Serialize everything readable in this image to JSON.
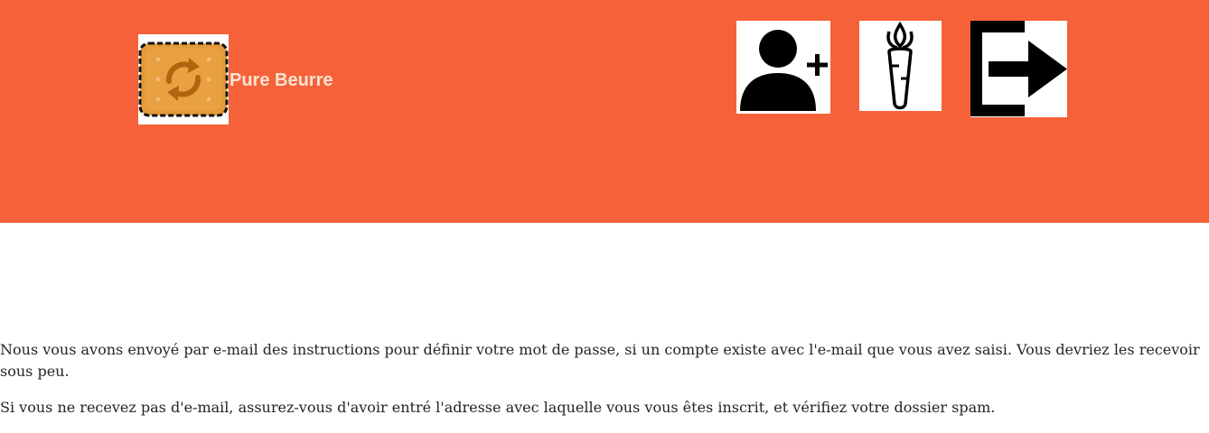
{
  "header": {
    "brand_name": "Pure Beurre",
    "background_color": "#f5623a",
    "logo_icon": "biscuit-refresh-logo-icon",
    "nav_icons": [
      "add-user-icon",
      "carrot-icon",
      "logout-icon"
    ]
  },
  "main": {
    "message_1": "Nous vous avons envoyé par e-mail des instructions pour définir votre mot de passe, si un compte existe avec l'e-mail que vous avez saisi. Vous devriez les recevoir sous peu.",
    "message_2": "Si vous ne recevez pas d'e-mail, assurez-vous d'avoir entré l'adresse avec laquelle vous vous êtes inscrit, et vérifiez votre dossier spam."
  }
}
